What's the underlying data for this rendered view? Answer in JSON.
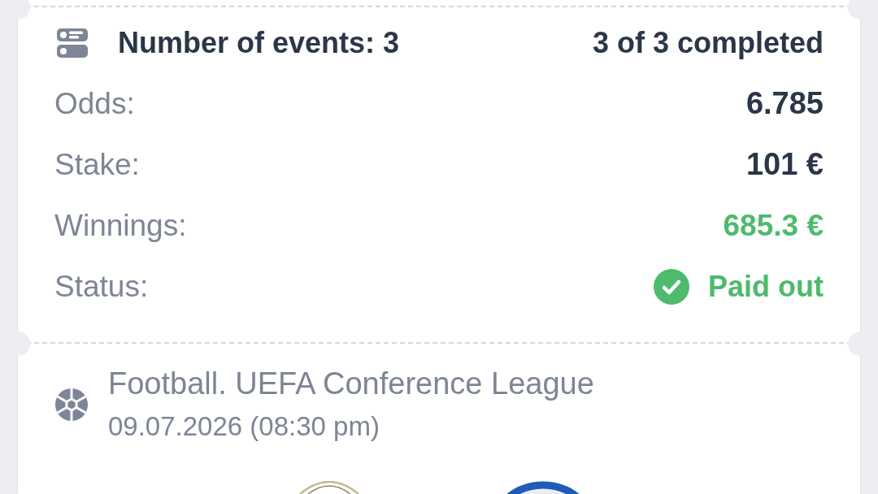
{
  "summary": {
    "events_label": "Number of events: 3",
    "progress": "3 of 3 completed",
    "rows": [
      {
        "kind": "plain",
        "label": "Odds:",
        "value": "6.785"
      },
      {
        "kind": "plain",
        "label": "Stake:",
        "value": "101 €"
      },
      {
        "kind": "win",
        "label": "Winnings:",
        "value": "685.3 €"
      },
      {
        "kind": "status",
        "label": "Status:",
        "value": "Paid out"
      }
    ]
  },
  "event": {
    "kind": "football",
    "title": "Football. UEFA Conference League",
    "date": "09.07.2026 (08:30 pm)",
    "teams": [
      {
        "kind": "crest"
      },
      {
        "kind": "ring"
      }
    ]
  }
}
